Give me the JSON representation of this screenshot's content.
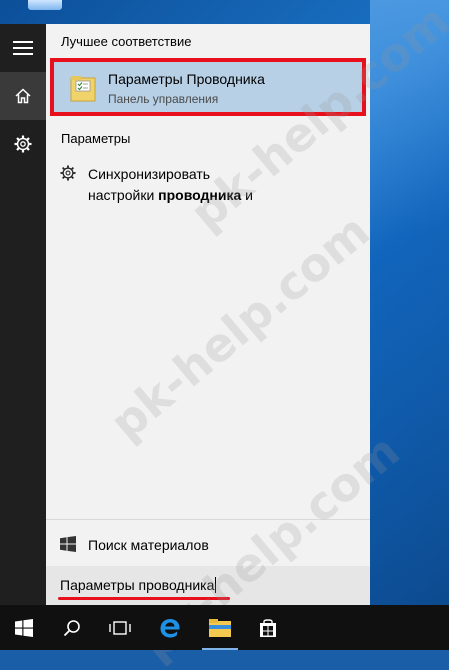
{
  "watermark": "pk-help.com",
  "panel": {
    "best_match_header": "Лучшее соответствие",
    "best_match": {
      "title": "Параметры Проводника",
      "subtitle": "Панель управления"
    },
    "settings_header": "Параметры",
    "settings_result": {
      "line1": "Синхронизировать",
      "line2_prefix": "настройки ",
      "line2_bold": "проводника",
      "line2_suffix": " и"
    },
    "search_web_label": "Поиск материалов",
    "search_query": "Параметры проводника"
  },
  "colors": {
    "highlight_border": "#e8101d",
    "selected_bg": "#b7d0e6",
    "rail_bg": "#1f1f1f",
    "taskbar_bg": "#101010"
  },
  "rail": {
    "icons": [
      "hamburger-icon",
      "home-icon",
      "gear-icon"
    ]
  },
  "taskbar": {
    "icons": [
      "windows-start-icon",
      "search-icon",
      "task-view-icon",
      "edge-icon",
      "file-explorer-icon",
      "store-icon"
    ]
  }
}
